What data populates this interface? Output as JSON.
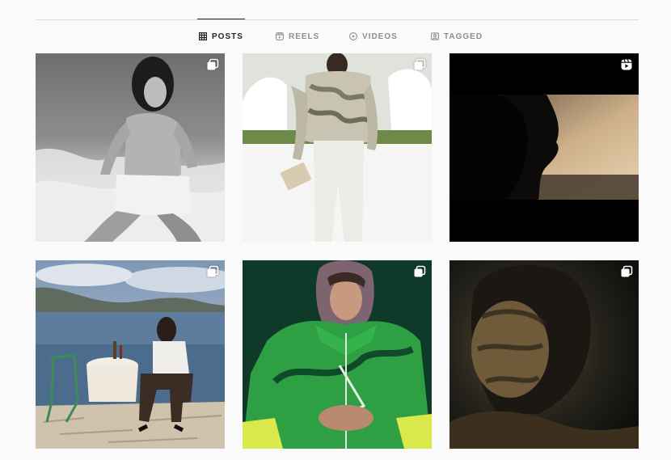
{
  "tabs": [
    {
      "label": "POSTS",
      "icon": "grid-icon",
      "active": true
    },
    {
      "label": "REELS",
      "icon": "reels-icon",
      "active": false
    },
    {
      "label": "VIDEOS",
      "icon": "play-icon",
      "active": false
    },
    {
      "label": "TAGGED",
      "icon": "tagged-icon",
      "active": false
    }
  ],
  "posts": [
    {
      "badge": "carousel-icon",
      "scene": "black-and-white portrait, man sitting in sea surf"
    },
    {
      "badge": "carousel-icon",
      "scene": "runway model in printed jacket and white trousers"
    },
    {
      "badge": "reel-icon",
      "scene": "silhouetted profile against sunset, letterboxed video"
    },
    {
      "badge": "carousel-icon",
      "scene": "man seated at seaside table with coastline"
    },
    {
      "badge": "carousel-icon",
      "scene": "man in green zip jacket with knit hood"
    },
    {
      "badge": "carousel-icon",
      "scene": "dark moody close-up portrait"
    }
  ],
  "colors": {
    "active_tab": "#262626",
    "inactive_tab": "#8e8e8e",
    "divider": "#dbdbdb",
    "background": "#fafafa"
  }
}
